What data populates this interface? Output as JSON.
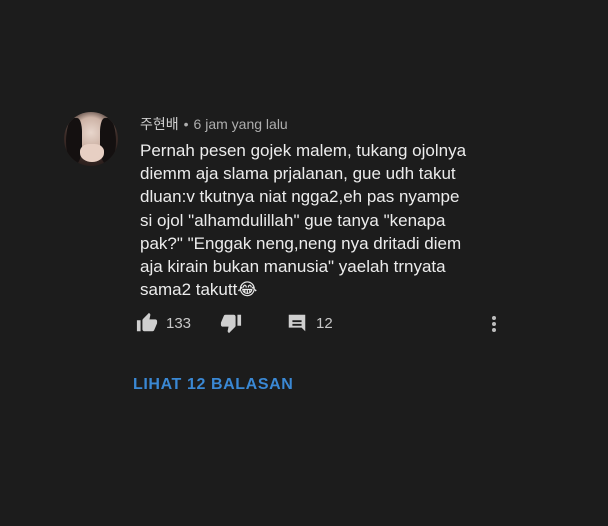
{
  "comment": {
    "author": "주현배",
    "separator": "•",
    "timestamp": "6 jam yang lalu",
    "lines": [
      "Pernah pesen gojek malem, tukang ojolnya",
      "diemm aja slama prjalanan, gue udh takut",
      "dluan:v tkutnya niat ngga2,eh pas nyampe",
      "si ojol \"alhamdulillah\" gue tanya \"kenapa",
      "pak?\" \"Enggak neng,neng nya dritadi diem",
      "aja kirain bukan manusia\" yaelah trnyata",
      "sama2 takutt😂"
    ],
    "like_count": "133",
    "reply_count": "12"
  },
  "icons": {
    "like": "thumbs-up-icon",
    "dislike": "thumbs-down-icon",
    "reply": "comment-icon",
    "more": "more-vert-icon"
  },
  "view_replies_label": "LIHAT 12 BALASAN",
  "colors": {
    "background": "#1c1c1c",
    "link": "#3a88d4",
    "text": "#ececec",
    "meta": "#aeaeae"
  }
}
